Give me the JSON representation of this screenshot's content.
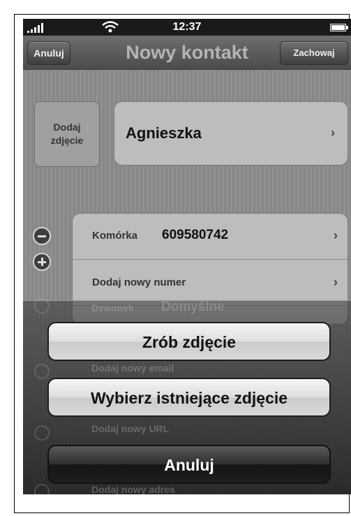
{
  "status": {
    "time": "12:37"
  },
  "nav": {
    "cancel": "Anuluj",
    "title": "Nowy kontakt",
    "save": "Zachowaj"
  },
  "photo": {
    "label1": "Dodaj",
    "label2": "zdjęcie"
  },
  "name": {
    "value": "Agnieszka"
  },
  "phones": [
    {
      "label": "Komórka",
      "value": "609580742"
    },
    {
      "label": "Dodaj nowy numer"
    }
  ],
  "behind": {
    "ringtone_label": "Dzwonek",
    "ringtone_value": "Domyślne",
    "add_email": "Dodaj nowy email",
    "add_url": "Dodaj nowy URL",
    "add_address": "Dodaj nowy adres"
  },
  "action_sheet": {
    "take_photo": "Zrób zdjęcie",
    "choose_photo": "Wybierz istniejące zdjęcie",
    "cancel": "Anuluj"
  }
}
